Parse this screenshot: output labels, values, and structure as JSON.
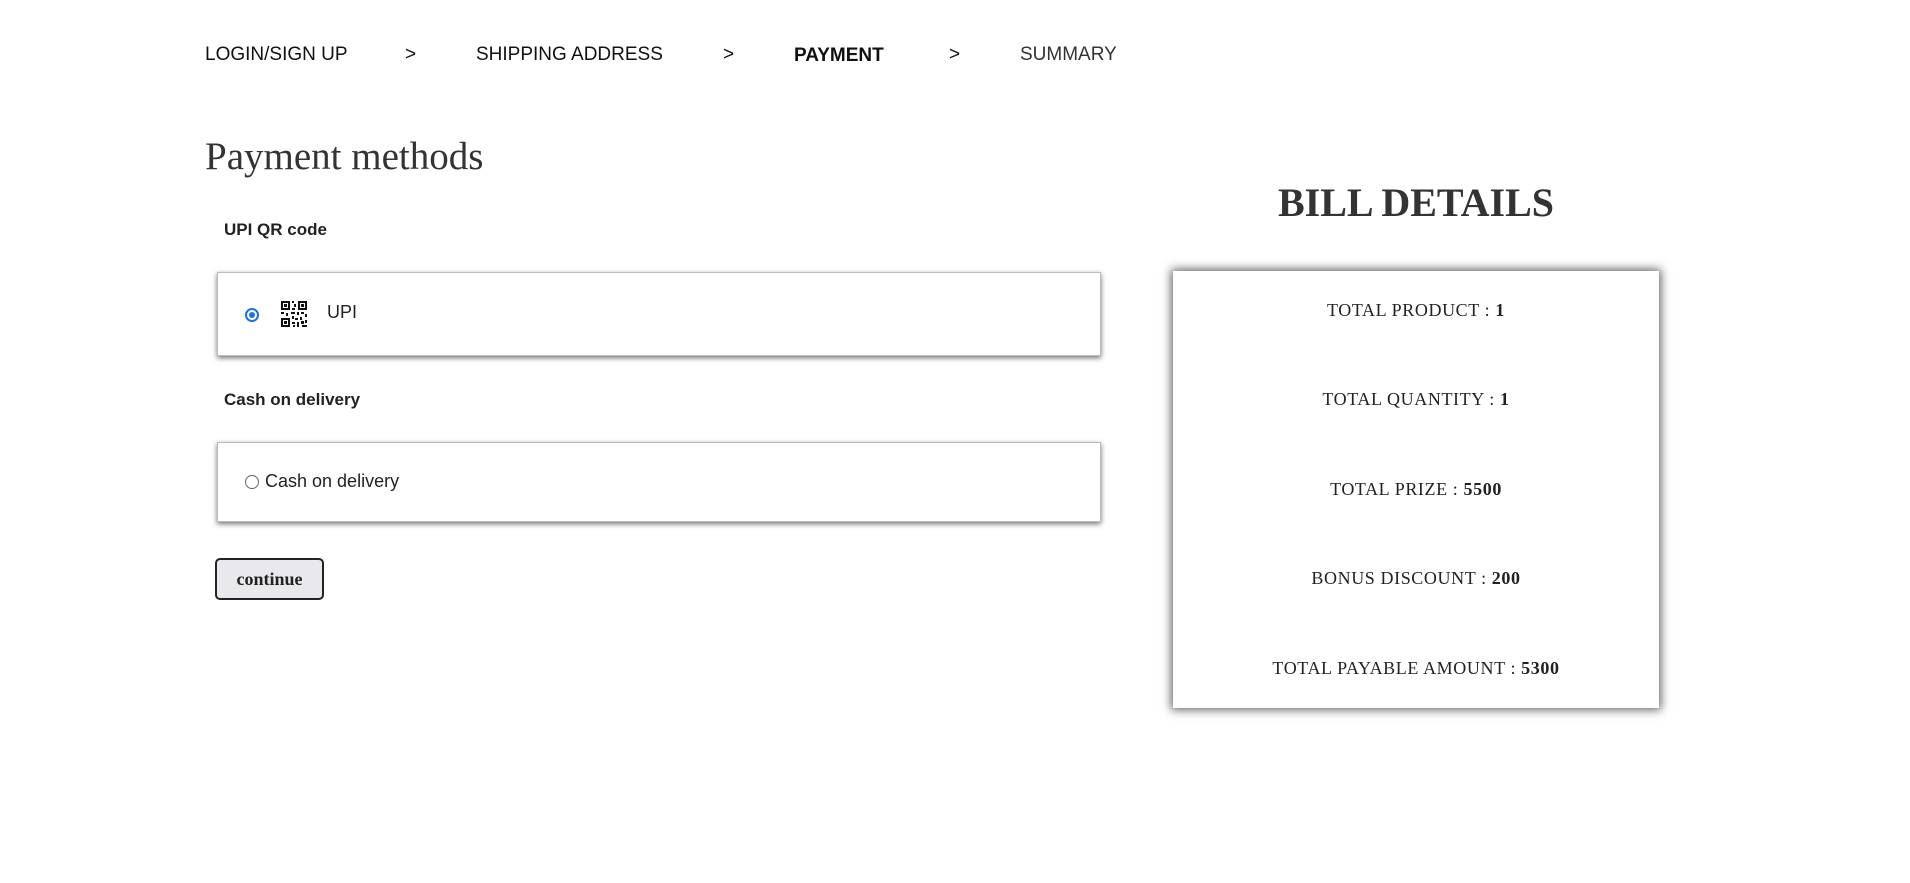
{
  "steps": {
    "login": "LOGIN/SIGN UP",
    "sep1": ">",
    "shipping": "SHIPPING ADDRESS",
    "sep2": ">",
    "payment": "PAYMENT",
    "sep3": ">",
    "summary": "SUMMARY"
  },
  "title": "Payment methods",
  "upi_section": {
    "label": "UPI QR code",
    "option_label": "UPI",
    "selected": true,
    "icon": "qr-code-icon"
  },
  "cod_section": {
    "label": "Cash on delivery",
    "option_label": "Cash on delivery",
    "selected": false
  },
  "continue_label": "continue",
  "bill": {
    "title": "BILL DETAILS",
    "rows": [
      {
        "label": "TOTAL PRODUCT : ",
        "value": "1"
      },
      {
        "label": "TOTAL QUANTITY : ",
        "value": "1"
      },
      {
        "label": "TOTAL PRIZE : ",
        "value": "5500"
      },
      {
        "label": "BONUS DISCOUNT : ",
        "value": "200"
      },
      {
        "label": "TOTAL PAYABLE AMOUNT : ",
        "value": "5300"
      }
    ]
  },
  "colors": {
    "radio_accent": "#1a73e8"
  }
}
